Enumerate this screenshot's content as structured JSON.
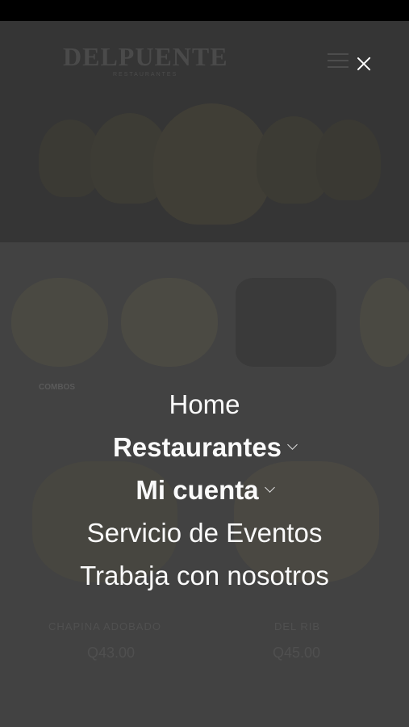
{
  "brand": {
    "logo_text": "DELPUENTE",
    "logo_subtitle": "RESTAURANTES"
  },
  "icons": {
    "menu": "hamburger-menu-icon",
    "close": "close-icon",
    "submenu": "chevron-down-icon"
  },
  "background": {
    "category_label": "COMBOS",
    "products": [
      {
        "name": "CHAPINA ADOBADO",
        "price": "Q43.00"
      },
      {
        "name": "DEL RIB",
        "price": "Q45.00"
      }
    ]
  },
  "menu": {
    "items": [
      {
        "label": "Home",
        "has_submenu": false
      },
      {
        "label": "Restaurantes",
        "has_submenu": true
      },
      {
        "label": "Mi cuenta",
        "has_submenu": true
      },
      {
        "label": "Servicio de Eventos",
        "has_submenu": false
      },
      {
        "label": "Trabaja con nosotros",
        "has_submenu": false
      }
    ]
  },
  "colors": {
    "overlay": "#3f3f3f",
    "menu_text": "#fafafa",
    "status_bar": "#000000"
  }
}
